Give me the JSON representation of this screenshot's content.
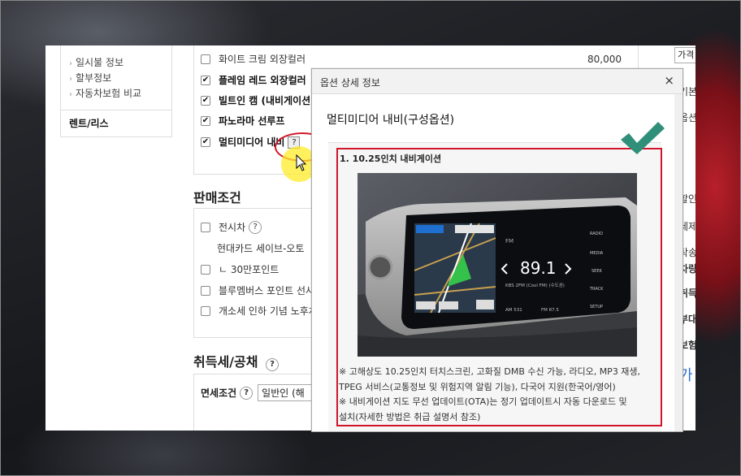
{
  "sidebar": {
    "items": [
      "일시불 정보",
      "할부정보",
      "자동차보험 비교"
    ],
    "rent": "렌트/리스"
  },
  "options": {
    "rows": [
      {
        "label": "화이트 크림 외장컬러",
        "checked": false,
        "price": "80,000"
      },
      {
        "label": "플레임 레드 외장컬러",
        "checked": true
      },
      {
        "label": "빌트인 캠 (내비게이션",
        "checked": true
      },
      {
        "label": "파노라마 선루프",
        "checked": true
      },
      {
        "label": "멀티미디어 내비",
        "checked": true,
        "help": "?"
      }
    ]
  },
  "sale": {
    "title": "판매조건",
    "rows": [
      {
        "label": "전시차",
        "help": "?"
      },
      {
        "label": "현대카드 세이브-오토"
      },
      {
        "label": "ㄴ 30만포인트"
      },
      {
        "label": "블루멤버스 포인트 선사"
      },
      {
        "label": "개소세 인하 기념 노후차"
      }
    ]
  },
  "tax": {
    "title": "취득세/공채",
    "help": "?",
    "condition_label": "면세조건",
    "condition_help": "?",
    "condition_value": "일반인 (해"
  },
  "right_col": {
    "box": "가격",
    "texts": [
      "기본",
      "옵션",
      "할인",
      "세제",
      "탁송",
      "차량",
      "취득",
      "부대",
      "보험",
      "가"
    ]
  },
  "modal": {
    "header": "옵션 상세 정보",
    "close": "×",
    "title": "멀티미디어 내비(구성옵션)",
    "feature": "1. 10.25인치 내비게이션",
    "screen": {
      "freq": "89.1",
      "band": "FM",
      "station": "KBS 2FM (Cool FM) (수도권)",
      "am": "AM 531",
      "fm": "FM 87.5",
      "buttons": [
        "RADIO",
        "MEDIA",
        "SEEK",
        "TRACK",
        "SETUP"
      ]
    },
    "desc": [
      "※ 고해상도 10.25인치 터치스크린, 고화질 DMB 수신 가능, 라디오, MP3 재생,",
      "TPEG 서비스(교통정보 및 위험지역 알림 기능), 다국어 지원(한국어/영어)",
      "※ 내비게이션 지도 무선 업데이트(OTA)는 정기 업데이트시 자동 다운로드 및",
      "설치(자세한 방법은 취급 설명서 참조)"
    ]
  },
  "colors": {
    "accent_red": "#d0152a",
    "check_green": "#2f8f78"
  }
}
